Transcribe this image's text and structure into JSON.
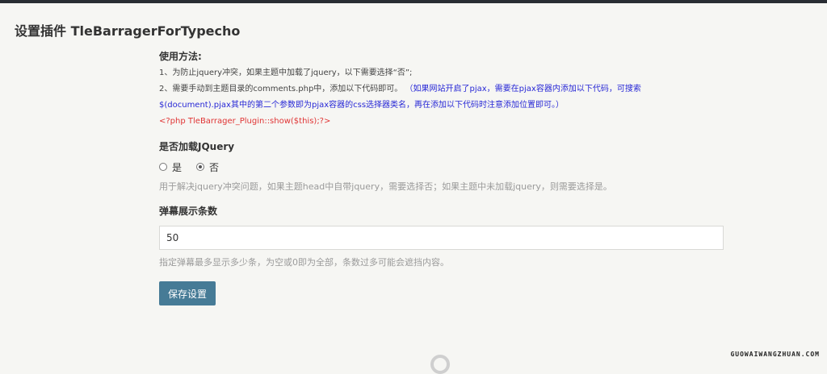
{
  "page": {
    "title": "设置插件 TleBarragerForTypecho"
  },
  "usage": {
    "title": "使用方法:",
    "line1": "1、为防止jquery冲突，如果主题中加载了jquery，以下需要选择“否”;",
    "line2_prefix": "2、需要手动到主题目录的comments.php中，添加以下代码即可。",
    "line2_blue": "（如果网站开启了pjax，需要在pjax容器内添加以下代码，可搜索",
    "line3_blue": "$(document).pjax其中的第二个参数即为pjax容器的css选择器类名，再在添加以下代码时注意添加位置即可。）",
    "code": "<?php TleBarrager_Plugin::show($this);?>"
  },
  "jquery_option": {
    "title": "是否加载JQuery",
    "options": [
      {
        "label": "是",
        "checked": false
      },
      {
        "label": "否",
        "checked": true
      }
    ],
    "description": "用于解决jquery冲突问题，如果主题head中自带jquery，需要选择否；如果主题中未加载jquery，则需要选择是。"
  },
  "count_option": {
    "title": "弹幕展示条数",
    "value": "50",
    "description": "指定弹幕最多显示多少条，为空或0即为全部，条数过多可能会遮挡内容。"
  },
  "actions": {
    "save_label": "保存设置"
  },
  "watermark": {
    "text": "GUOWAIWANGZHUAN.COM"
  },
  "colors": {
    "accent": "#467b96",
    "topbar": "#292d33",
    "link_blue": "#2828d6",
    "code_red": "#e03434",
    "background": "#f6f6f3"
  }
}
